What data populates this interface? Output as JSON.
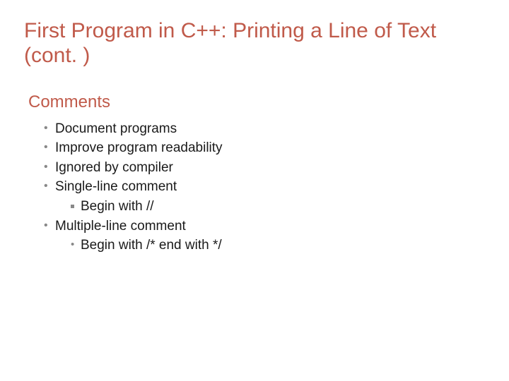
{
  "title": "First Program in C++: Printing a Line of Text (cont. )",
  "section": "Comments",
  "bullets": {
    "b0": "Document programs",
    "b1": "Improve program readability",
    "b2": "Ignored by compiler",
    "b3": "Single-line comment",
    "b3s0": "Begin with //",
    "b4": "Multiple-line comment",
    "b4s0": "Begin with /* end with */"
  }
}
